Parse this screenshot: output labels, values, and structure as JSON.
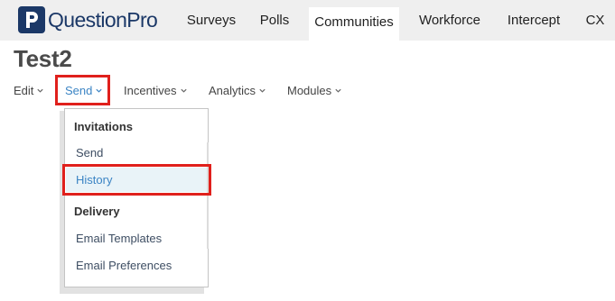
{
  "brand": {
    "logo_letter": "P",
    "logo_text": "QuestionPro",
    "logo_color": "#1b3867"
  },
  "top_nav": {
    "tabs": [
      {
        "label": "Surveys"
      },
      {
        "label": "Polls"
      },
      {
        "label": "Communities",
        "active": true
      },
      {
        "label": "Workforce"
      },
      {
        "label": "Intercept"
      },
      {
        "label": "CX"
      }
    ]
  },
  "page": {
    "title": "Test2"
  },
  "submenu": {
    "items": [
      {
        "label": "Edit"
      },
      {
        "label": "Send",
        "active": true
      },
      {
        "label": "Incentives"
      },
      {
        "label": "Analytics"
      },
      {
        "label": "Modules"
      }
    ]
  },
  "dropdown": {
    "sections": [
      {
        "heading": "Invitations",
        "items": [
          {
            "label": "Send"
          },
          {
            "label": "History",
            "highlighted": true
          }
        ]
      },
      {
        "heading": "Delivery",
        "items": [
          {
            "label": "Email Templates"
          },
          {
            "label": "Email Preferences"
          }
        ]
      }
    ]
  },
  "colors": {
    "accent": "#3b84c4",
    "highlight_border": "#e0201c",
    "highlight_fill": "#e9f3f8",
    "topbar_bg": "#efefef"
  }
}
